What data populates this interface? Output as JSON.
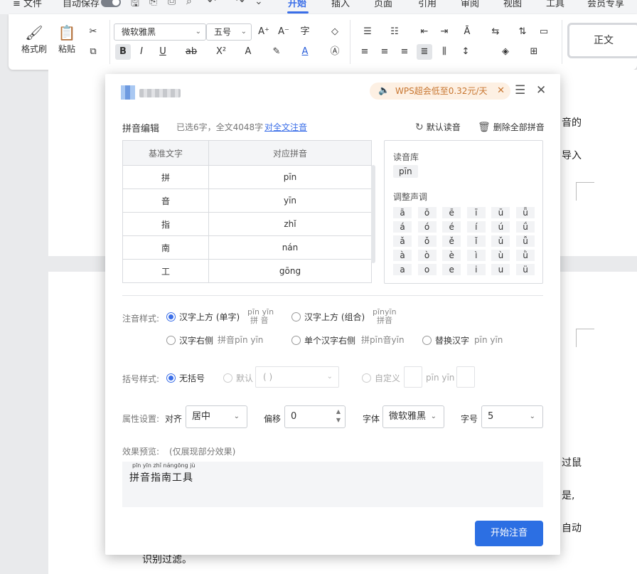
{
  "menubar": {
    "file": "≡ 文件",
    "autosave": "自动保存",
    "tabs": [
      "开始",
      "插入",
      "页面",
      "引用",
      "审阅",
      "视图",
      "工具",
      "会员专享"
    ]
  },
  "ribbon": {
    "format_painter": "格式刷",
    "paste": "粘贴",
    "font_name": "微软雅黑",
    "font_size": "五号",
    "style_normal": "正文"
  },
  "document": {
    "right_snippets": [
      "音的",
      "导入",
      "过鼠",
      "是,",
      "自动"
    ],
    "bottom_text": "识别过滤。"
  },
  "dialog": {
    "promo": "WPS超会低至0.32元/天",
    "section_title": "拼音编辑",
    "selection_info": "已选6字，全文4048字",
    "full_annotate_link": "对全文注音",
    "default_reading": "默认读音",
    "delete_all": "删除全部拼音",
    "table": {
      "headers": [
        "基准文字",
        "对应拼音"
      ],
      "rows": [
        [
          "拼",
          "pīn"
        ],
        [
          "音",
          "yīn"
        ],
        [
          "指",
          "zhǐ"
        ],
        [
          "南",
          "nán"
        ],
        [
          "工",
          "gōng"
        ]
      ]
    },
    "library": {
      "title": "读音库",
      "current": "pīn",
      "tone_title": "调整声调",
      "tones": [
        [
          "ā",
          "ō",
          "ē",
          "ī",
          "ū",
          "ǖ"
        ],
        [
          "á",
          "ó",
          "é",
          "í",
          "ú",
          "ǘ"
        ],
        [
          "ǎ",
          "ǒ",
          "ě",
          "ǐ",
          "ǔ",
          "ǚ"
        ],
        [
          "à",
          "ò",
          "è",
          "ì",
          "ù",
          "ǜ"
        ],
        [
          "a",
          "o",
          "e",
          "i",
          "u",
          "ü"
        ]
      ]
    },
    "style": {
      "label": "注音样式:",
      "opt_above_single": "汉字上方 (单字)",
      "ex_above_single_py": "pīn yīn",
      "ex_above_single_hz": "拼 音",
      "opt_above_combo": "汉字上方 (组合)",
      "ex_above_combo_py": "pīnyīn",
      "ex_above_combo_hz": "拼音",
      "opt_right": "汉字右侧",
      "ex_right": "拼音pīn yīn",
      "opt_single_right": "单个汉字右侧",
      "ex_single_right": "拼pīn音yīn",
      "opt_replace": "替换汉字",
      "ex_replace": "pīn yīn"
    },
    "bracket": {
      "label": "括号样式:",
      "opt_none": "无括号",
      "opt_default": "默认",
      "default_value": "( )",
      "opt_custom": "自定义",
      "custom_example": "pīn yīn"
    },
    "props": {
      "label": "属性设置:",
      "align_label": "对齐",
      "align_value": "居中",
      "offset_label": "偏移",
      "offset_value": "0",
      "font_label": "字体",
      "font_value": "微软雅黑",
      "size_label": "字号",
      "size_value": "5"
    },
    "preview": {
      "label": "效果预览:",
      "note": "(仅展现部分效果)",
      "pinyin": "pīn yīn zhǐ nángōng jù",
      "text": "拼音指南工具"
    },
    "start_button": "开始注音"
  },
  "colors": {
    "accent": "#2c6fe3",
    "link": "#3a6ee8",
    "promo_text": "#c7752f",
    "promo_bg": "#fdf0e3"
  }
}
